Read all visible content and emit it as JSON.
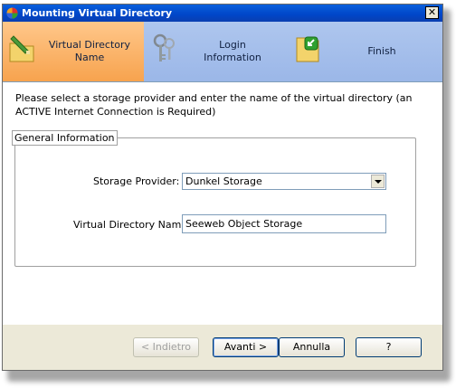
{
  "window": {
    "title": "Mounting Virtual Directory"
  },
  "steps": [
    {
      "label": "Virtual Directory\nName",
      "active": true,
      "icon": "folder-edit-icon"
    },
    {
      "label": "Login\nInformation",
      "active": false,
      "icon": "keys-icon"
    },
    {
      "label": "Finish",
      "active": false,
      "icon": "finish-icon"
    }
  ],
  "instruction": "Please select a storage provider and enter the name of the virtual directory (an ACTIVE Internet Connection is Required)",
  "group": {
    "title": "General Information",
    "storage_label": "Storage Provider:",
    "storage_value": "Dunkel Storage",
    "name_label": "Virtual Directory Name",
    "name_value": "Seeweb Object Storage"
  },
  "buttons": {
    "back": "< Indietro",
    "next": "Avanti >",
    "cancel": "Annulla",
    "help": "?"
  },
  "colors": {
    "title_bar": "#0a5fdc",
    "active_step": "#f7a34e",
    "steps_bar": "#aec6ee"
  }
}
